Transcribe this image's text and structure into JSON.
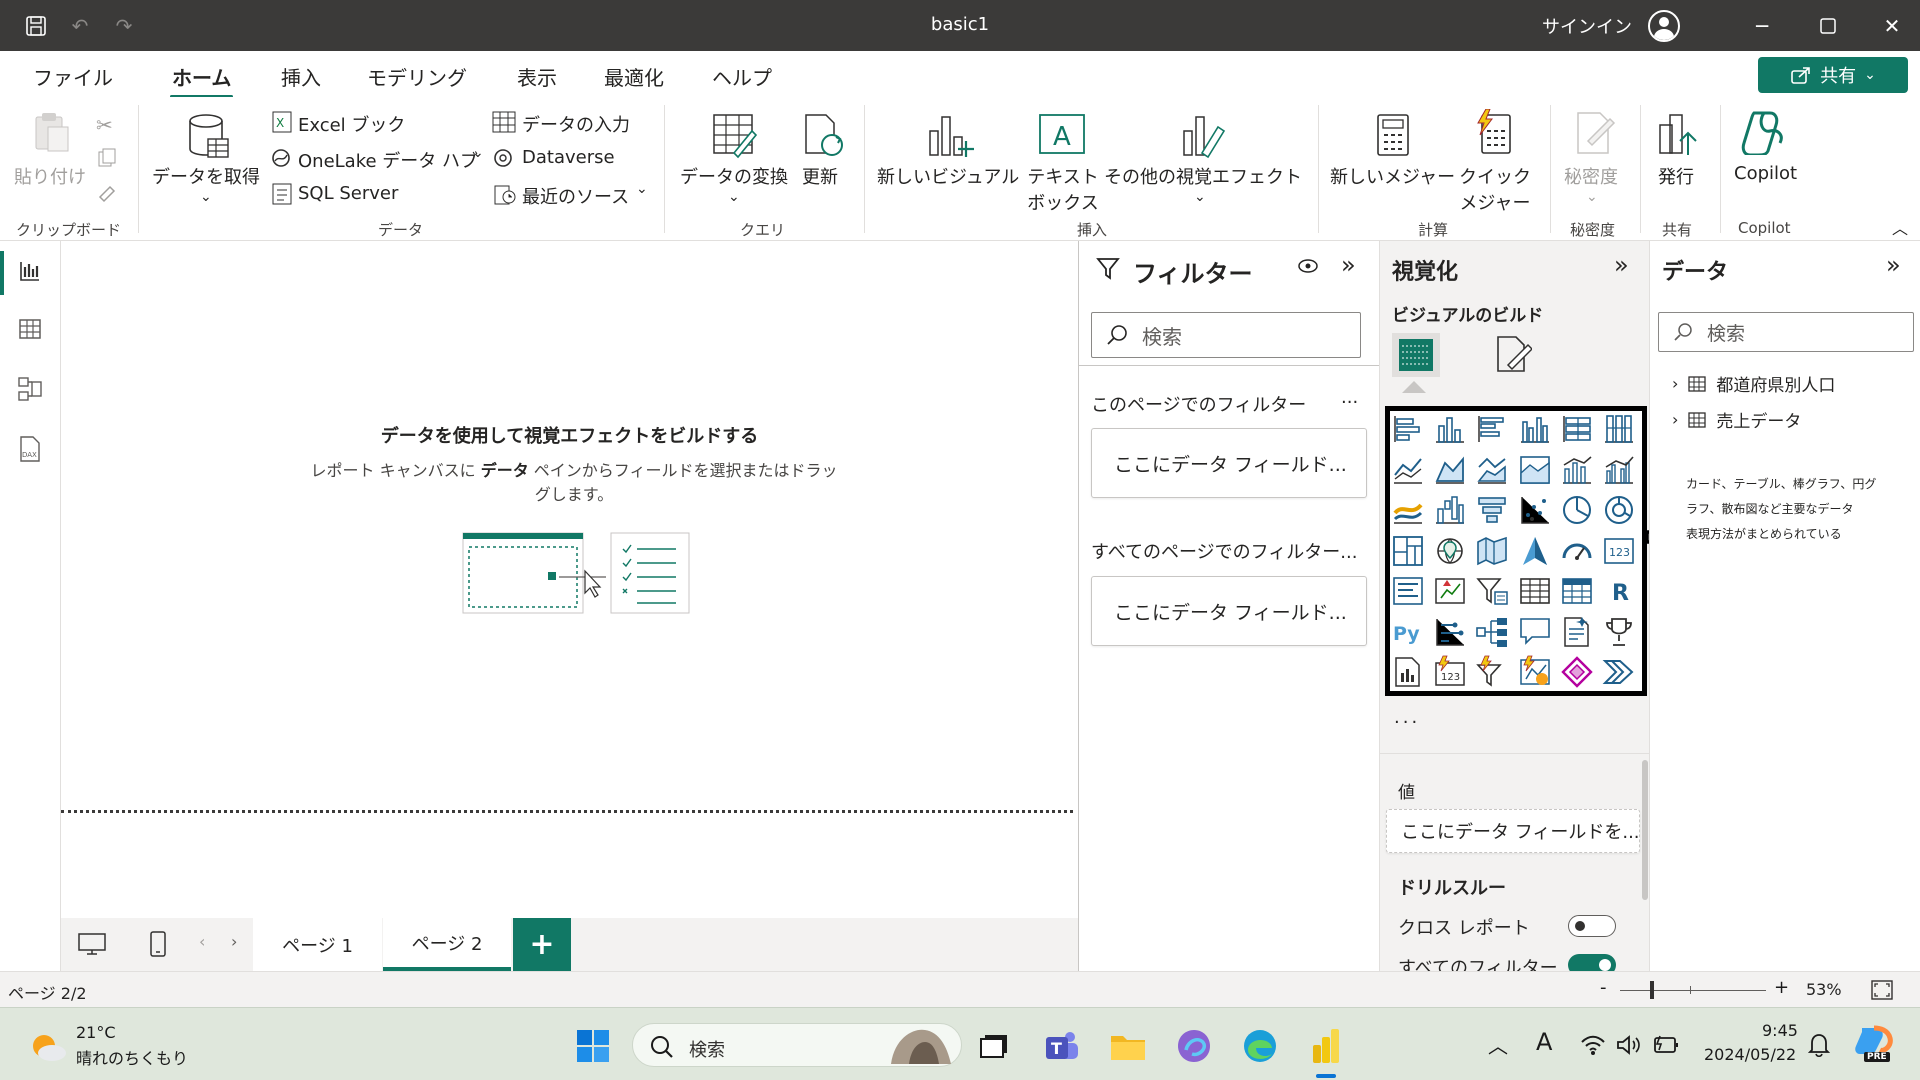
{
  "titlebar": {
    "title": "basic1",
    "signin": "サインイン"
  },
  "menu": {
    "items": [
      "ファイル",
      "ホーム",
      "挿入",
      "モデリング",
      "表示",
      "最適化",
      "ヘルプ"
    ],
    "share": "共有"
  },
  "ribbon": {
    "paste": "貼り付け",
    "clipboard_group": "クリップボード",
    "get_data": "データを取得",
    "excel": "Excel ブック",
    "onelake": "OneLake データ ハブ",
    "sql": "SQL Server",
    "enter_data": "データの入力",
    "dataverse": "Dataverse",
    "recent": "最近のソース",
    "data_group": "データ",
    "transform": "データの変換",
    "refresh": "更新",
    "query_group": "クエリ",
    "new_visual": "新しいビジュアル",
    "textbox_1": "テキスト",
    "textbox_2": "ボックス",
    "more_visuals": "その他の視覚エフェクト",
    "insert_group": "挿入",
    "new_measure": "新しいメジャー",
    "quick_1": "クイック",
    "quick_2": "メジャー",
    "calc_group": "計算",
    "sensitivity": "秘密度",
    "sensitivity_group": "秘密度",
    "publish": "発行",
    "share_group": "共有",
    "copilot": "Copilot",
    "copilot_group": "Copilot"
  },
  "canvas": {
    "empty_title": "データを使用して視覚エフェクトをビルドする",
    "desc_1": "レポート キャンバスに ",
    "desc_bold": "データ",
    "desc_2": " ペインからフィールドを選択またはドラッグします。"
  },
  "pages": {
    "tabs": [
      "ページ 1",
      "ページ 2"
    ],
    "active": 1,
    "add": "+"
  },
  "filters": {
    "title": "フィルター",
    "search_placeholder": "検索",
    "this_page": "このページでのフィルター",
    "all_pages": "すべてのページでのフィルター...",
    "well": "ここにデータ フィールド...",
    "more": "..."
  },
  "viz": {
    "title": "視覚化",
    "build": "ビジュアルのビルド",
    "more": "...",
    "values_label": "値",
    "values_well": "ここにデータ フィールドを...",
    "drill": "ドリルスルー",
    "cross_report": "クロス レポート",
    "cross_report_on": false,
    "all_filters": "すべてのフィルター",
    "all_filters_on": true,
    "python_label": "Py",
    "r_label": "R",
    "card_label": "123"
  },
  "data": {
    "title": "データ",
    "search_placeholder": "検索",
    "tables": [
      "都道府県別人口",
      "売上データ"
    ],
    "note_lines": [
      "カード、テーブル、棒グラフ、円グ",
      "ラフ、散布図など主要なデータ",
      "表現方法がまとめられている"
    ]
  },
  "status": {
    "page": "ページ 2/2",
    "zoom": "53%",
    "minus": "-",
    "plus": "+"
  },
  "taskbar": {
    "temp": "21°C",
    "weather": "晴れのちくもり",
    "search": "検索",
    "ime": "A",
    "time": "9:45",
    "date": "2024/05/22",
    "pre": "PRE"
  },
  "colors": {
    "accent": "#117865",
    "titlebar": "#3b3a39"
  }
}
